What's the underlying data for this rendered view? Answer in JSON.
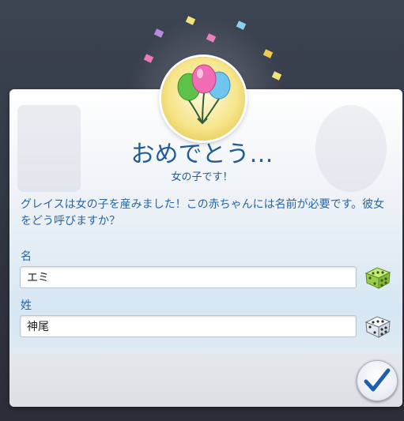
{
  "dialog": {
    "title": "おめでとう…",
    "subtitle": "女の子です！",
    "message": "グレイスは女の子を産みました！この赤ちゃんには名前が必要です。彼女をどう呼びますか？",
    "first_name": {
      "label": "名",
      "value": "エミ"
    },
    "last_name": {
      "label": "姓",
      "value": "神尾"
    }
  },
  "icons": {
    "medallion": "balloons-icon",
    "randomize_first": "dice-icon",
    "randomize_last": "dice-icon",
    "confirm": "checkmark-icon"
  },
  "colors": {
    "text_blue": "#2566a8",
    "title_blue": "#1f5a9b",
    "medallion_gold": "#f6e58a",
    "dice_green": "#9acd4a",
    "check_blue": "#1d5fb0"
  }
}
